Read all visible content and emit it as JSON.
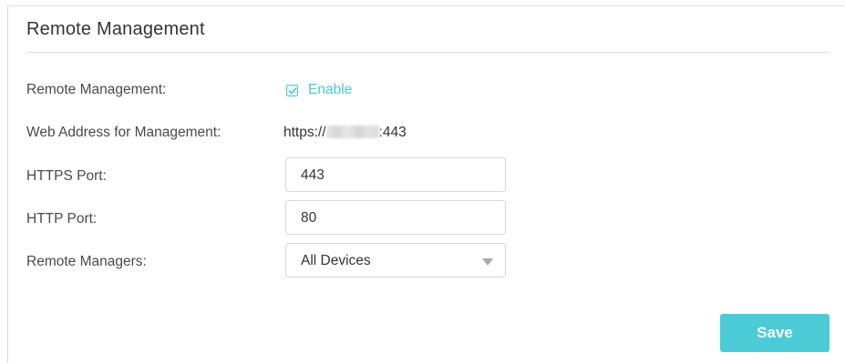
{
  "section": {
    "title": "Remote Management"
  },
  "fields": {
    "remote_management": {
      "label": "Remote Management:",
      "checkbox_checked": true,
      "checkbox_label": "Enable"
    },
    "web_address": {
      "label": "Web Address for Management:",
      "prefix": "https://",
      "suffix": ":443"
    },
    "https_port": {
      "label": "HTTPS Port:",
      "value": "443"
    },
    "http_port": {
      "label": "HTTP Port:",
      "value": "80"
    },
    "remote_managers": {
      "label": "Remote Managers:",
      "selected": "All Devices"
    }
  },
  "actions": {
    "save_label": "Save"
  },
  "colors": {
    "accent": "#4acbd6",
    "text": "#333333",
    "label": "#4a4a4a",
    "border": "#d6d6d6"
  },
  "icons": {
    "checkbox": "checkmark-icon",
    "dropdown": "caret-down-icon"
  }
}
